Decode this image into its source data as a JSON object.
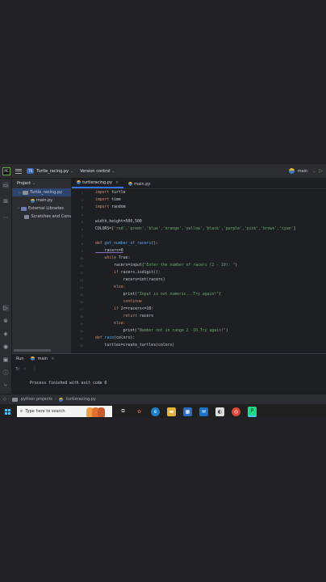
{
  "titlebar": {
    "project_badge": "TR",
    "project_name": "Turtle_racing.py",
    "version_control": "Version control",
    "branch": "main"
  },
  "project_panel": {
    "header": "Project",
    "items": [
      {
        "label": "Turtle_racing.py"
      },
      {
        "label": "main.py"
      },
      {
        "label": "External Libraries"
      },
      {
        "label": "Scratches and Cons"
      }
    ]
  },
  "tabs": [
    {
      "label": "turtleracing.py"
    },
    {
      "label": "main.py"
    }
  ],
  "line_numbers": [
    "1",
    "2",
    "3",
    "4",
    "5",
    "6",
    "7",
    "8",
    "9",
    "10",
    "11",
    "12",
    "13",
    "14",
    "15",
    "16",
    "17",
    "18",
    "19",
    "20",
    "21",
    "22"
  ],
  "code": {
    "l1_kw": "import",
    "l1_rest": " turtle",
    "l2_kw": "import",
    "l2_rest": " time",
    "l3_kw": "import",
    "l3_rest": " random",
    "l5": "width,height=500,500",
    "l6_a": "COLORS=[",
    "l6_str": "'red','green','blue','orange','yellow','black','purple','pink','brown','cyan'",
    "l6_b": "]",
    "l8_kw": "def",
    "l8_fn": " get_number_of_racers",
    "l8_rest": "():",
    "l9": "    racers=0",
    "l10_kw": "    while",
    "l10_rest": " True:",
    "l11_a": "        racers=input(",
    "l11_str": "\"Enter the number of racers (2 - 10): \"",
    "l11_b": ")",
    "l12_kw": "        if",
    "l12_rest": " racers.isdigit():",
    "l13": "            racers=int(racers)",
    "l14_kw": "        else:",
    "l15_a": "            print(",
    "l15_str": "\"Input is not numeric...Try again!\"",
    "l15_b": ")",
    "l16_kw": "            continue",
    "l17_kw": "        if",
    "l17_rest": " 2<=racers<=10:",
    "l18_kw": "            return",
    "l18_rest": " racers",
    "l19_kw": "        else:",
    "l20_a": "            print(",
    "l20_str": "\"Number not in range 2 -10.Try again!\"",
    "l20_b": ")",
    "l21_kw": "def",
    "l21_fn": " race",
    "l21_rest": "(colors):",
    "l22": "    turtles=create_turtles(colors)"
  },
  "run_panel": {
    "title": "Run",
    "config": "main",
    "output": "Process finished with exit code 0"
  },
  "statusbar": {
    "crumb1": "python projects",
    "crumb2": "turtleracing.py"
  },
  "taskbar": {
    "search_placeholder": "Type here to search"
  }
}
